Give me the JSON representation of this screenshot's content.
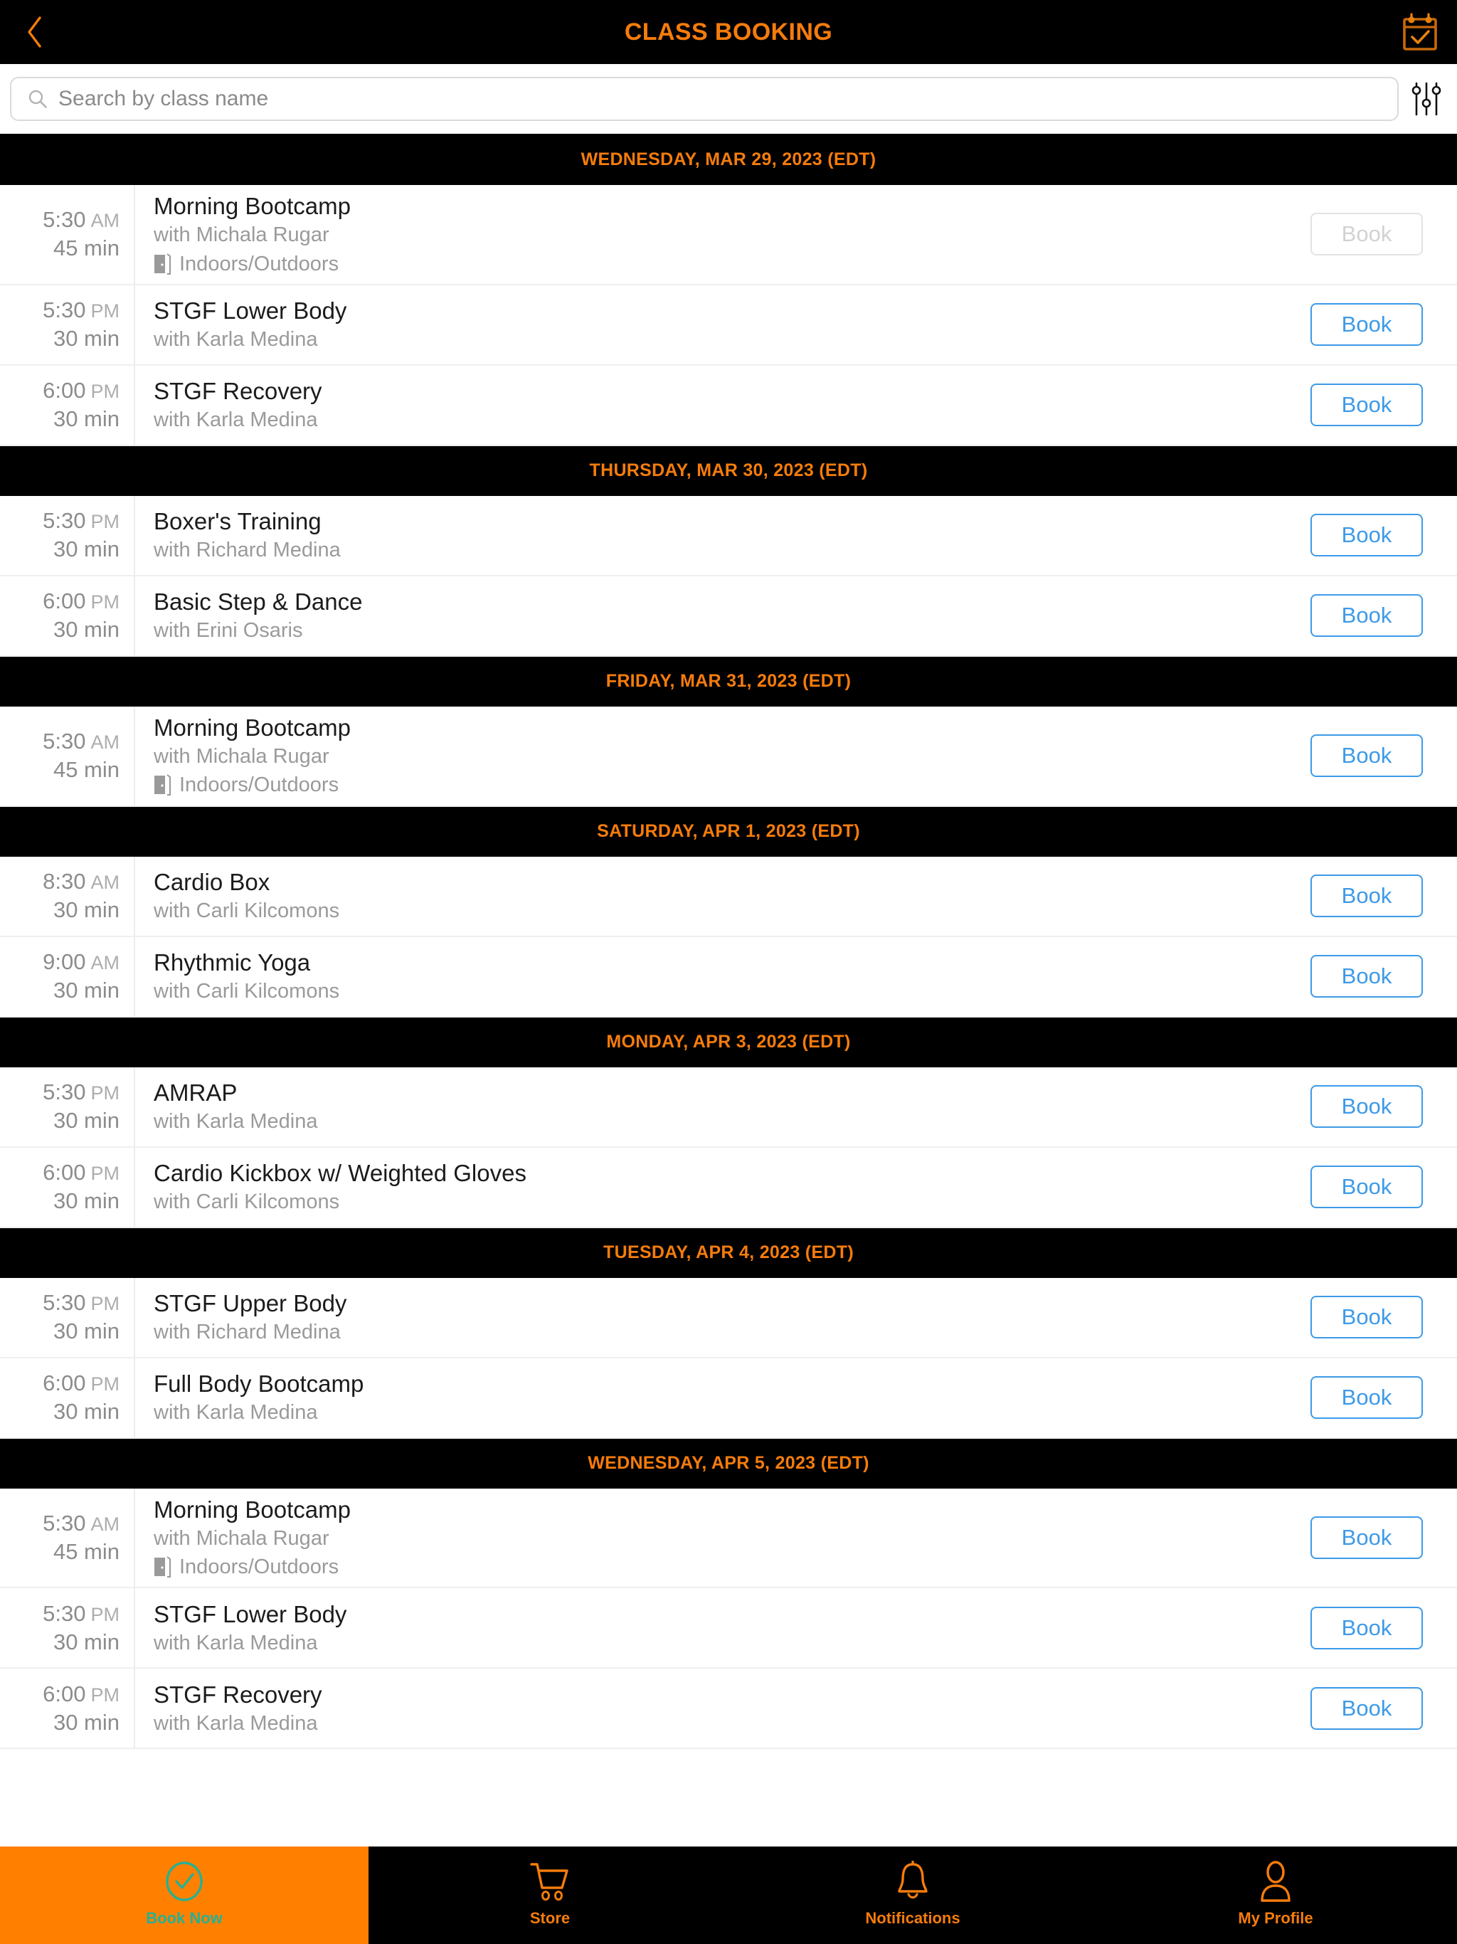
{
  "header": {
    "title": "CLASS BOOKING",
    "back_icon": "chevron-left-icon",
    "calendar_icon": "calendar-check-icon"
  },
  "search": {
    "placeholder": "Search by class name",
    "value": "",
    "search_icon": "search-icon",
    "filter_icon": "filter-sliders-icon"
  },
  "labels": {
    "book": "Book",
    "with_prefix": "with",
    "location_icon": "door-icon"
  },
  "days": [
    {
      "date_label": "WEDNESDAY, MAR 29, 2023 (EDT)",
      "classes": [
        {
          "time": "5:30",
          "ampm": "AM",
          "duration": "45 min",
          "name": "Morning Bootcamp",
          "instructor": "with Michala Rugar",
          "location": "Indoors/Outdoors",
          "book_label": "Book",
          "disabled": true
        },
        {
          "time": "5:30",
          "ampm": "PM",
          "duration": "30 min",
          "name": "STGF Lower Body",
          "instructor": "with Karla Medina",
          "location": "",
          "book_label": "Book",
          "disabled": false
        },
        {
          "time": "6:00",
          "ampm": "PM",
          "duration": "30 min",
          "name": "STGF Recovery",
          "instructor": "with Karla Medina",
          "location": "",
          "book_label": "Book",
          "disabled": false
        }
      ]
    },
    {
      "date_label": "THURSDAY, MAR 30, 2023 (EDT)",
      "classes": [
        {
          "time": "5:30",
          "ampm": "PM",
          "duration": "30 min",
          "name": "Boxer's Training",
          "instructor": "with Richard Medina",
          "location": "",
          "book_label": "Book",
          "disabled": false
        },
        {
          "time": "6:00",
          "ampm": "PM",
          "duration": "30 min",
          "name": "Basic Step & Dance",
          "instructor": "with Erini Osaris",
          "location": "",
          "book_label": "Book",
          "disabled": false
        }
      ]
    },
    {
      "date_label": "FRIDAY, MAR 31, 2023 (EDT)",
      "classes": [
        {
          "time": "5:30",
          "ampm": "AM",
          "duration": "45 min",
          "name": "Morning Bootcamp",
          "instructor": "with Michala Rugar",
          "location": "Indoors/Outdoors",
          "book_label": "Book",
          "disabled": false
        }
      ]
    },
    {
      "date_label": "SATURDAY, APR 1, 2023 (EDT)",
      "classes": [
        {
          "time": "8:30",
          "ampm": "AM",
          "duration": "30 min",
          "name": "Cardio Box",
          "instructor": "with Carli Kilcomons",
          "location": "",
          "book_label": "Book",
          "disabled": false
        },
        {
          "time": "9:00",
          "ampm": "AM",
          "duration": "30 min",
          "name": "Rhythmic Yoga",
          "instructor": "with Carli Kilcomons",
          "location": "",
          "book_label": "Book",
          "disabled": false
        }
      ]
    },
    {
      "date_label": "MONDAY, APR 3, 2023 (EDT)",
      "classes": [
        {
          "time": "5:30",
          "ampm": "PM",
          "duration": "30 min",
          "name": "AMRAP",
          "instructor": "with Karla Medina",
          "location": "",
          "book_label": "Book",
          "disabled": false
        },
        {
          "time": "6:00",
          "ampm": "PM",
          "duration": "30 min",
          "name": "Cardio Kickbox w/ Weighted Gloves",
          "instructor": "with Carli Kilcomons",
          "location": "",
          "book_label": "Book",
          "disabled": false
        }
      ]
    },
    {
      "date_label": "TUESDAY, APR 4, 2023 (EDT)",
      "classes": [
        {
          "time": "5:30",
          "ampm": "PM",
          "duration": "30 min",
          "name": "STGF Upper Body",
          "instructor": "with Richard Medina",
          "location": "",
          "book_label": "Book",
          "disabled": false
        },
        {
          "time": "6:00",
          "ampm": "PM",
          "duration": "30 min",
          "name": "Full Body Bootcamp",
          "instructor": "with Karla Medina",
          "location": "",
          "book_label": "Book",
          "disabled": false
        }
      ]
    },
    {
      "date_label": "WEDNESDAY, APR 5, 2023 (EDT)",
      "classes": [
        {
          "time": "5:30",
          "ampm": "AM",
          "duration": "45 min",
          "name": "Morning Bootcamp",
          "instructor": "with Michala Rugar",
          "location": "Indoors/Outdoors",
          "book_label": "Book",
          "disabled": false
        },
        {
          "time": "5:30",
          "ampm": "PM",
          "duration": "30 min",
          "name": "STGF Lower Body",
          "instructor": "with Karla Medina",
          "location": "",
          "book_label": "Book",
          "disabled": false
        },
        {
          "time": "6:00",
          "ampm": "PM",
          "duration": "30 min",
          "name": "STGF Recovery",
          "instructor": "with Karla Medina",
          "location": "",
          "book_label": "Book",
          "disabled": false
        }
      ]
    }
  ],
  "bottom_nav": [
    {
      "label": "Book Now",
      "icon": "check-circle-icon",
      "active": true
    },
    {
      "label": "Store",
      "icon": "shopping-cart-icon",
      "active": false
    },
    {
      "label": "Notifications",
      "icon": "bell-icon",
      "active": false
    },
    {
      "label": "My Profile",
      "icon": "user-icon",
      "active": false
    }
  ],
  "colors": {
    "accent_orange": "#F57C0C",
    "active_tab_bg": "#FF8000",
    "active_tab_fg": "#27B093",
    "book_blue": "#3D9AE8",
    "header_bg": "#000000"
  }
}
